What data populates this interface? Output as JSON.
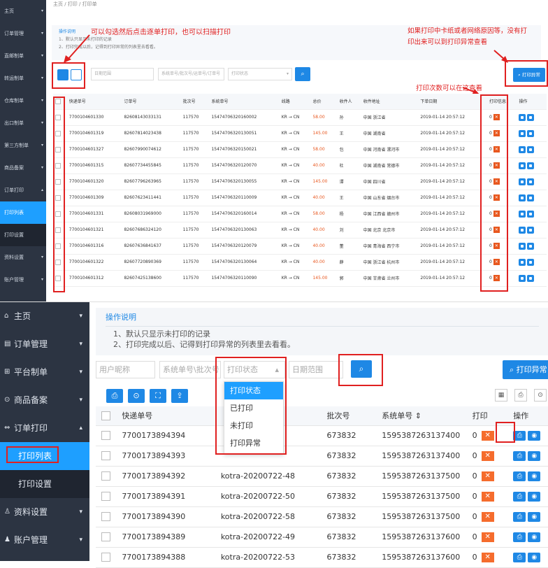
{
  "top": {
    "breadcrumb": "主页 / 打印 / 打印单",
    "sidebar": [
      {
        "label": "主页",
        "arrow": "▾"
      },
      {
        "label": "订单管理",
        "arrow": "▾"
      },
      {
        "label": "直邮制单",
        "arrow": "▾"
      },
      {
        "label": "转运制单",
        "arrow": "▾"
      },
      {
        "label": "仓库制单",
        "arrow": "▾"
      },
      {
        "label": "出口制单",
        "arrow": "▾"
      },
      {
        "label": "第三方制单",
        "arrow": "▾"
      },
      {
        "label": "商品备案",
        "arrow": "▾"
      },
      {
        "label": "订单打印",
        "arrow": "▴"
      },
      {
        "label": "打印列表",
        "arrow": ""
      },
      {
        "label": "打印设置",
        "arrow": ""
      },
      {
        "label": "资料设置",
        "arrow": "▾"
      },
      {
        "label": "账户管理",
        "arrow": "▾"
      }
    ],
    "hint_title": "操作说明",
    "hint_lines": [
      "1、默认只显示未打印的记录",
      "2、打印完成以后，记得到打印异常的列表里去看看。"
    ],
    "note_left": "可以勾选然后点击逐单打印，也可以扫描打印",
    "note_right": "如果打印中卡纸或者网络原因等，没有打印出来可以到打印异常查看",
    "note_count": "打印次数可以在这查看",
    "filter_date": "日期范围",
    "filter_sys": "系统单号/批次号/运单号/订单号",
    "filter_status": "打印状态",
    "btn_exception": "打印异常",
    "headers": [
      "快递单号",
      "订单号",
      "批次号",
      "系统单号",
      "线路",
      "总价",
      "收件人",
      "收件地址",
      "下单日期",
      "打印信息",
      "操作"
    ],
    "rows": [
      [
        "7700104601330",
        "82608143033131",
        "117570",
        "15474706320160002",
        "KR → CN",
        "58.00",
        "孙",
        "中国 浙江省",
        "2019-01-14 20:57:12",
        "0"
      ],
      [
        "7700104601319",
        "82607814023438",
        "117570",
        "15474706320130051",
        "KR → CN",
        "145.00",
        "王",
        "中国 湖南省",
        "2019-01-14 20:57:12",
        "0"
      ],
      [
        "7700104601327",
        "82607990074612",
        "117570",
        "15474706320150021",
        "KR → CN",
        "58.00",
        "包",
        "中国 河南省 漯河市",
        "2019-01-14 20:57:12",
        "0"
      ],
      [
        "7700104601315",
        "82607734455845",
        "117570",
        "15474706320120070",
        "KR → CN",
        "40.00",
        "杜",
        "中国 湖南省 常德市",
        "2019-01-14 20:57:12",
        "0"
      ],
      [
        "7700104601320",
        "82607796263965",
        "117570",
        "15474706320130055",
        "KR → CN",
        "145.00",
        "谭",
        "中国 四川省",
        "2019-01-14 20:57:12",
        "0"
      ],
      [
        "7700104601309",
        "82607623411441",
        "117570",
        "15474706320110009",
        "KR → CN",
        "40.00",
        "王",
        "中国 山东省 烟台市",
        "2019-01-14 20:57:12",
        "0"
      ],
      [
        "7700104601331",
        "82608031969000",
        "117570",
        "15474706320160014",
        "KR → CN",
        "58.00",
        "杨",
        "中国 江西省 赣州市",
        "2019-01-14 20:57:12",
        "0"
      ],
      [
        "7700104601321",
        "82607686324120",
        "117570",
        "15474706320130063",
        "KR → CN",
        "40.00",
        "刘",
        "中国 北京 北京市",
        "2019-01-14 20:57:12",
        "0"
      ],
      [
        "7700104601316",
        "82607636841637",
        "117570",
        "15474706320120079",
        "KR → CN",
        "40.00",
        "董",
        "中国 青海省 西宁市",
        "2019-01-14 20:57:12",
        "0"
      ],
      [
        "7700104601322",
        "82607720890369",
        "117570",
        "15474706320130064",
        "KR → CN",
        "40.00",
        "薛",
        "中国 浙江省 杭州市",
        "2019-01-14 20:57:12",
        "0"
      ],
      [
        "7700104601312",
        "82607425138600",
        "117570",
        "15474706320110090",
        "KR → CN",
        "145.00",
        "郭",
        "中国 甘肃省 兰州市",
        "2019-01-14 20:57:12",
        "0"
      ]
    ]
  },
  "bottom": {
    "sidebar": [
      {
        "icon": "⌂",
        "label": "主页",
        "arrow": "▾",
        "kind": "main"
      },
      {
        "icon": "▤",
        "label": "订单管理",
        "arrow": "▾",
        "kind": "main"
      },
      {
        "icon": "⊞",
        "label": "平台制单",
        "arrow": "▾",
        "kind": "main"
      },
      {
        "icon": "⊙",
        "label": "商品备案",
        "arrow": "▾",
        "kind": "main"
      },
      {
        "icon": "⇔",
        "label": "订单打印",
        "arrow": "▴",
        "kind": "main"
      },
      {
        "icon": "",
        "label": "打印列表",
        "arrow": "",
        "kind": "active"
      },
      {
        "icon": "",
        "label": "打印设置",
        "arrow": "",
        "kind": "sub"
      },
      {
        "icon": "♙",
        "label": "资料设置",
        "arrow": "▾",
        "kind": "main"
      },
      {
        "icon": "♟",
        "label": "账户管理",
        "arrow": "▾",
        "kind": "main"
      }
    ],
    "hint_title": "操作说明",
    "hint_lines": [
      "1、默认只显示未打印的记录",
      "2、打印完成以后、记得到打印异常的列表里去看看。"
    ],
    "filter_user": "用户昵称",
    "filter_sys": "系统单号\\批次号",
    "filter_status": "打印状态",
    "filter_date": "日期范围",
    "btn_exception": "打印异常",
    "dropdown": [
      "打印状态",
      "已打印",
      "未打印",
      "打印异常"
    ],
    "headers": [
      "快递单号",
      "",
      "批次号",
      "系统单号 ⇕",
      "打印",
      "操作"
    ],
    "rows": [
      [
        "7700173894394",
        "",
        "673832",
        "1595387263137400",
        "0"
      ],
      [
        "7700173894393",
        "",
        "673832",
        "1595387263137400",
        "0"
      ],
      [
        "7700173894392",
        "kotra-20200722-48",
        "673832",
        "1595387263137500",
        "0"
      ],
      [
        "7700173894391",
        "kotra-20200722-50",
        "673832",
        "1595387263137500",
        "0"
      ],
      [
        "7700173894390",
        "kotra-20200722-58",
        "673832",
        "1595387263137500",
        "0"
      ],
      [
        "7700173894389",
        "kotra-20200722-49",
        "673832",
        "1595387263137600",
        "0"
      ],
      [
        "7700173894388",
        "kotra-20200722-53",
        "673832",
        "1595387263137600",
        "0"
      ]
    ]
  },
  "colors": {
    "accent": "#1e9fff",
    "sidebar": "#2c3442",
    "annotation": "#e02020",
    "danger": "#e8571e"
  },
  "close_glyph": "✕"
}
